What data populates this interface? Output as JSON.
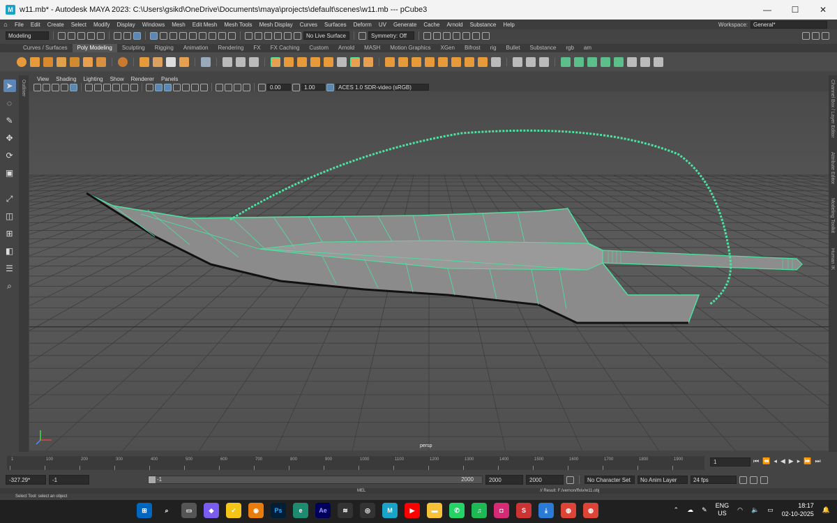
{
  "window": {
    "title": "w11.mb* - Autodesk MAYA 2023: C:\\Users\\gsikd\\OneDrive\\Documents\\maya\\projects\\default\\scenes\\w11.mb   ---   pCube3",
    "app_icon": "M",
    "minimize": "—",
    "maximize": "☐",
    "close": "✕"
  },
  "menu": [
    "File",
    "Edit",
    "Create",
    "Select",
    "Modify",
    "Display",
    "Windows",
    "Mesh",
    "Edit Mesh",
    "Mesh Tools",
    "Mesh Display",
    "Curves",
    "Surfaces",
    "Deform",
    "UV",
    "Generate",
    "Cache",
    "Arnold",
    "Substance",
    "Help"
  ],
  "workspace": {
    "label": "Workspace:",
    "value": "General*"
  },
  "statusline": {
    "mode": "Modeling",
    "live_surface": "No Live Surface",
    "symmetry": "Symmetry: Off"
  },
  "shelf_tabs": [
    {
      "label": "Curves / Surfaces",
      "active": false
    },
    {
      "label": "Poly Modeling",
      "active": true
    },
    {
      "label": "Sculpting",
      "active": false
    },
    {
      "label": "Rigging",
      "active": false
    },
    {
      "label": "Animation",
      "active": false
    },
    {
      "label": "Rendering",
      "active": false
    },
    {
      "label": "FX",
      "active": false
    },
    {
      "label": "FX Caching",
      "active": false
    },
    {
      "label": "Custom",
      "active": false
    },
    {
      "label": "Arnold",
      "active": false
    },
    {
      "label": "MASH",
      "active": false
    },
    {
      "label": "Motion Graphics",
      "active": false
    },
    {
      "label": "XGen",
      "active": false
    },
    {
      "label": "Bifrost",
      "active": false
    },
    {
      "label": "rig",
      "active": false
    },
    {
      "label": "Bullet",
      "active": false
    },
    {
      "label": "Substance",
      "active": false
    },
    {
      "label": "rgb",
      "active": false
    },
    {
      "label": "am",
      "active": false
    }
  ],
  "panel_menu": [
    "View",
    "Shading",
    "Lighting",
    "Show",
    "Renderer",
    "Panels"
  ],
  "panel_toolbar": {
    "exposure": "0.00",
    "gamma": "1.00",
    "colorspace": "ACES 1.0 SDR-video (sRGB)"
  },
  "side_labels": {
    "left": "Outliner",
    "right": [
      "Channel Box / Layer Editor",
      "Attribute Editor",
      "Modeling Toolkit",
      "Human IK"
    ]
  },
  "viewport": {
    "camera": "persp",
    "wire_color": "#4be3a0"
  },
  "timeline": {
    "ticks": [
      "1",
      "100",
      "200",
      "300",
      "400",
      "500",
      "600",
      "700",
      "800",
      "900",
      "1000",
      "1100",
      "1200",
      "1300",
      "1400",
      "1500",
      "1600",
      "1700",
      "1800",
      "1900"
    ],
    "current_frame": "1"
  },
  "range": {
    "current_time": "-327.29*",
    "start": "-1",
    "range_start": "-1",
    "range_end": "2000",
    "end1": "2000",
    "end2": "2000",
    "character": "No Character Set",
    "anim_layer": "No Anim Layer",
    "fps": "24 fps"
  },
  "command": {
    "lang": "MEL",
    "result": "// Result: F:/vernon/ffxiv/w11.obj"
  },
  "help": "Select Tool: select an object",
  "taskbar": {
    "lang": "ENG",
    "region": "US",
    "time": "18:17",
    "date": "02-10-2025"
  }
}
